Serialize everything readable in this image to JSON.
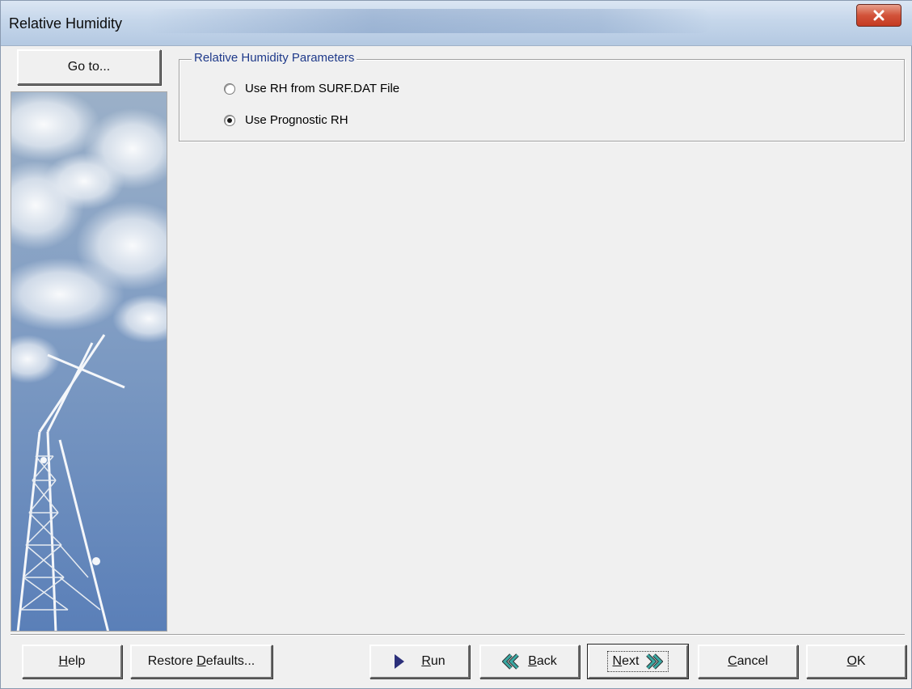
{
  "window": {
    "title": "Relative Humidity"
  },
  "sidebar": {
    "goto_label": "Go to..."
  },
  "group": {
    "label": "Relative Humidity Parameters",
    "options": [
      {
        "label": "Use RH from SURF.DAT File",
        "selected": false
      },
      {
        "label": "Use Prognostic RH",
        "selected": true
      }
    ]
  },
  "footer": {
    "help": {
      "mnemonic": "H",
      "rest": "elp"
    },
    "restore": {
      "pre": "Restore ",
      "mnemonic": "D",
      "rest": "efaults..."
    },
    "run": {
      "mnemonic": "R",
      "rest": "un"
    },
    "back": {
      "mnemonic": "B",
      "rest": "ack"
    },
    "next": {
      "mnemonic": "N",
      "rest": "ext"
    },
    "cancel": {
      "mnemonic": "C",
      "rest": "ancel"
    },
    "ok": {
      "mnemonic": "O",
      "rest": "K"
    }
  },
  "colors": {
    "group_label": "#1f3a8a",
    "run_arrow": "#2b2f7a",
    "nav_arrow": "#3aa9a4",
    "close": "#c43a22"
  },
  "icons": {
    "close": "close-icon",
    "run": "play-icon",
    "back": "back-double-chevron-icon",
    "next": "next-double-chevron-icon"
  }
}
